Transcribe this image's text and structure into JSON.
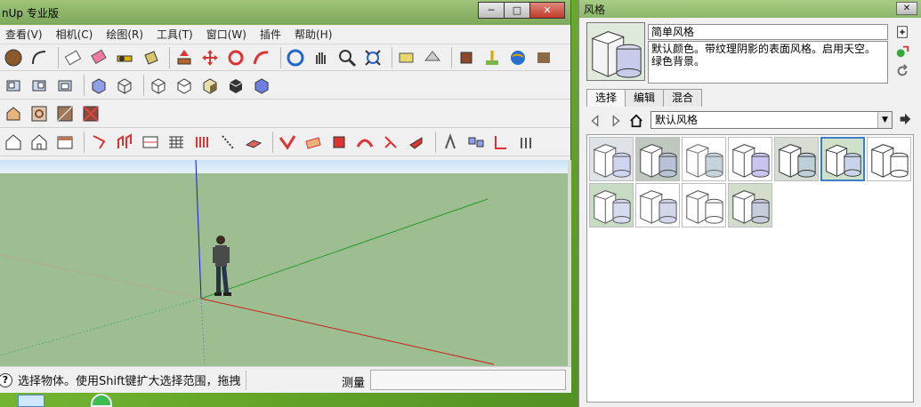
{
  "main_window": {
    "title": "nUp 专业版",
    "controls": [
      "─",
      "□",
      "✕"
    ],
    "menu": [
      "查看(V)",
      "相机(C)",
      "绘图(R)",
      "工具(T)",
      "窗口(W)",
      "插件",
      "帮助(H)"
    ],
    "status_text": "选择物体。使用Shift键扩大选择范围，拖拽",
    "measure_label": "测量",
    "measure_value": ""
  },
  "toolbars": {
    "row1": [
      "circle-tool",
      "arc-tool",
      "eraser-tool",
      "paint-tool",
      "tape-measure-tool",
      "bucket-tool",
      "push-pull-tool",
      "move-tool",
      "rotate-tool",
      "follow-me-tool",
      "orbit-tool",
      "pan-tool",
      "zoom-tool",
      "zoom-extents-tool",
      "get-models-tool",
      "share-model-tool",
      "component-tool",
      "add-location-tool",
      "google-earth-tool",
      "more-tool"
    ],
    "row2": [
      "front-view-tool",
      "back-view-tool",
      "left-view-tool",
      "xray-tool",
      "wireframe-tool",
      "hidden-line-tool",
      "shaded-tool",
      "shaded-texture-tool",
      "monochrome-tool"
    ],
    "row3": [
      "section-plane-tool",
      "section-cut-tool",
      "display-section-planes-tool",
      "display-section-cuts-tool"
    ],
    "row4": [
      "iso-view-tool",
      "top-view-tool",
      "front-elev-tool",
      "rect-extrude-tool",
      "sandbox-tool",
      "smoove-tool",
      "drape-tool",
      "stamp-tool",
      "flip-edge-tool",
      "add-detail-tool",
      "from-scratch-tool",
      "from-contours-tool",
      "slice-tool",
      "axes-tool",
      "dimension-tool",
      "text-tool",
      "pie-tool",
      "label-tool",
      "walk-tool",
      "position-camera-tool",
      "look-around-tool",
      "section-tool",
      "solid-tools"
    ]
  },
  "styles_panel": {
    "title": "风格",
    "close": "✕",
    "style_name": "简单风格",
    "style_description": "默认颜色。带纹理阴影的表面风格。启用天空。绿色背景。",
    "tabs": [
      "选择",
      "编辑",
      "混合"
    ],
    "active_tab": "选择",
    "collection": "默认风格",
    "thumbnails": [
      {
        "bg": "#dfe3e8",
        "fill": "#cfd4ef",
        "edge": "#555"
      },
      {
        "bg": "#bfc8bf",
        "fill": "#b9c1d6",
        "edge": "#444"
      },
      {
        "bg": "#ffffff",
        "fill": "#c7d3dc",
        "edge": "#666"
      },
      {
        "bg": "#ffffff",
        "fill": "#c7c6f0",
        "edge": "#444"
      },
      {
        "bg": "#d7ddd3",
        "fill": "#bfcfd8",
        "edge": "#333"
      },
      {
        "bg": "#cfe1c8",
        "fill": "#c8d4ea",
        "edge": "#333"
      },
      {
        "bg": "#ffffff",
        "fill": "#ffffff",
        "edge": "#333"
      },
      {
        "bg": "#c8dcc4",
        "fill": "#d7dbef",
        "edge": "#555"
      },
      {
        "bg": "#ffffff",
        "fill": "#d4d6ec",
        "edge": "#555"
      },
      {
        "bg": "#ffffff",
        "fill": "#ffffff",
        "edge": "#555"
      },
      {
        "bg": "#d3ddcc",
        "fill": "#c7ccdd",
        "edge": "#444"
      }
    ],
    "selected_index": 5
  }
}
